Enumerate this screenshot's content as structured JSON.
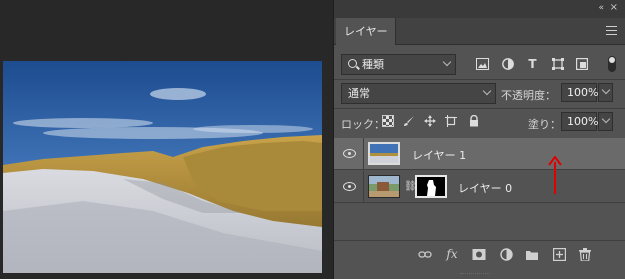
{
  "panel": {
    "collapse_glyph": "«",
    "close_glyph": "×",
    "tab_label": "レイヤー"
  },
  "filter": {
    "kind_label": "種類",
    "icons": [
      "image-filter-icon",
      "adjustment-filter-icon",
      "type-filter-icon",
      "shape-filter-icon",
      "smart-object-filter-icon",
      "filter-toggle-icon"
    ]
  },
  "blend": {
    "mode": "通常",
    "opacity_label": "不透明度：",
    "opacity_value": "100%"
  },
  "lock": {
    "label": "ロック：",
    "icons": [
      "lock-transparent-pixels-icon",
      "lock-image-pixels-icon",
      "lock-position-icon",
      "lock-artboard-icon",
      "lock-all-icon"
    ],
    "fill_label": "塗り：",
    "fill_value": "100%"
  },
  "layers": [
    {
      "name": "レイヤー 1",
      "selected": true,
      "visible": true
    },
    {
      "name": "レイヤー 0",
      "selected": false,
      "visible": true,
      "has_mask": true
    }
  ],
  "bottom_icons": [
    "link-layers-icon",
    "layer-style-fx-icon",
    "add-mask-icon",
    "adjustment-layer-icon",
    "new-group-icon",
    "new-layer-icon",
    "delete-layer-icon"
  ],
  "colors": {
    "panel_bg": "#535353",
    "selected_layer_bg": "#6a6a6a",
    "canvas_bg": "#282828",
    "annotation_arrow": "#e00000"
  },
  "glyphs": {
    "type_t": "T",
    "fx": "fx",
    "trash": "🗑",
    "plus": "+",
    "chain": "⛓"
  }
}
